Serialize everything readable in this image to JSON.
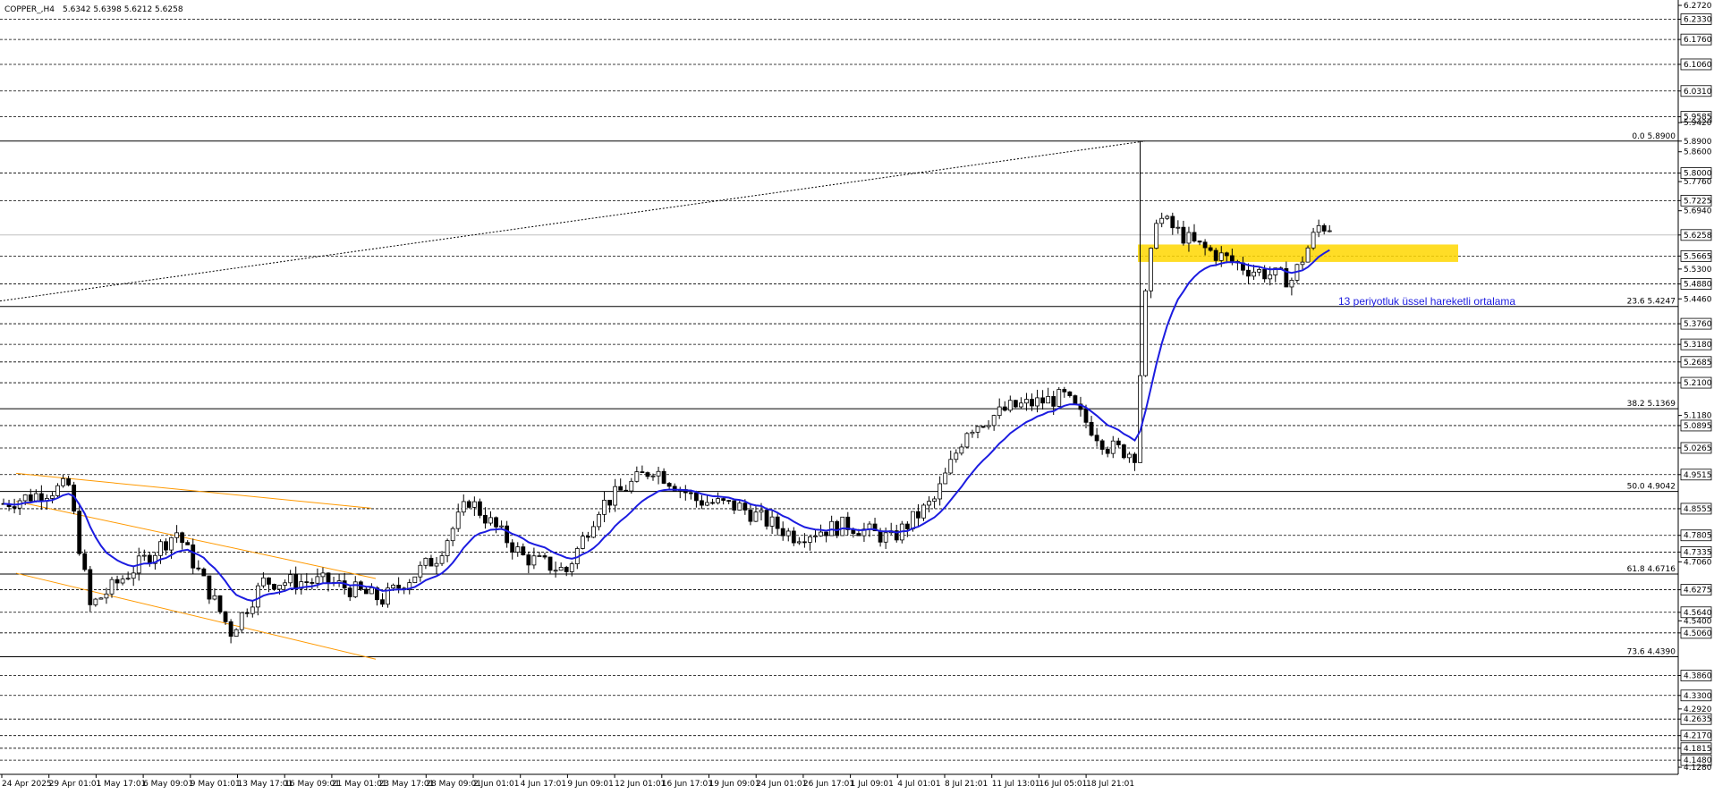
{
  "header": {
    "symbol": "COPPER_,H4",
    "ohlc": "5.6342 5.6398 5.6212 5.6258"
  },
  "chart_data": {
    "type": "candlestick",
    "title": "COPPER_,H4",
    "ylim": [
      4.108,
      6.272
    ],
    "grid": "horizontal dashed price levels",
    "price_axis_ticks": [
      "6.2720",
      "6.2330",
      "6.1760",
      "6.1060",
      "6.0310",
      "5.9585",
      "5.9420",
      "5.8900",
      "5.8600",
      "5.8000",
      "5.7760",
      "5.7225",
      "5.6940",
      "5.6258",
      "5.5665",
      "5.5300",
      "5.4880",
      "5.4460",
      "5.3760",
      "5.3180",
      "5.2685",
      "5.2100",
      "5.1180",
      "5.0895",
      "5.0265",
      "4.9515",
      "4.8555",
      "4.7805",
      "4.7335",
      "4.7060",
      "4.6275",
      "4.5640",
      "4.5400",
      "4.5060",
      "4.3860",
      "4.3300",
      "4.2920",
      "4.2635",
      "4.2170",
      "4.1815",
      "4.1480",
      "4.1280"
    ],
    "levels": [
      6.233,
      6.176,
      6.106,
      6.031,
      5.9585,
      5.8,
      5.7225,
      5.5665,
      5.488,
      5.376,
      5.318,
      5.2685,
      5.21,
      5.0895,
      5.0265,
      4.9515,
      4.8555,
      4.7805,
      4.7335,
      4.6275,
      4.564,
      4.506,
      4.386,
      4.33,
      4.2635,
      4.217,
      4.1815,
      4.148
    ],
    "current_price": 5.6258,
    "time_axis_labels": [
      "24 Apr 2025",
      "29 Apr 01:01",
      "1 May 17:01",
      "6 May 09:01",
      "9 May 01:01",
      "13 May 17:01",
      "16 May 09:01",
      "21 May 01:01",
      "23 May 17:01",
      "28 May 09:01",
      "2 Jun 01:01",
      "4 Jun 17:01",
      "9 Jun 09:01",
      "12 Jun 01:01",
      "16 Jun 17:01",
      "19 Jun 09:01",
      "24 Jun 01:01",
      "26 Jun 17:01",
      "1 Jul 09:01",
      "4 Jul 01:01",
      "8 Jul 21:01",
      "11 Jul 13:01",
      "16 Jul 05:01",
      "18 Jul 21:01"
    ],
    "fibonacci": [
      {
        "label": "0.0 5.8900",
        "price": 5.89
      },
      {
        "label": "23.6 5.4247",
        "price": 5.4247
      },
      {
        "label": "38.2 5.1369",
        "price": 5.1369
      },
      {
        "label": "50.0 4.9042",
        "price": 4.9042
      },
      {
        "label": "61.8 4.6716",
        "price": 4.6716
      },
      {
        "label": "73.6 4.4390",
        "price": 4.439
      }
    ],
    "anchor_prices": [
      {
        "bar": 0,
        "price": 4.87
      },
      {
        "bar": 12,
        "price": 4.92
      },
      {
        "bar": 16,
        "price": 4.58
      },
      {
        "bar": 22,
        "price": 4.66
      },
      {
        "bar": 32,
        "price": 4.79
      },
      {
        "bar": 42,
        "price": 4.51
      },
      {
        "bar": 48,
        "price": 4.65
      },
      {
        "bar": 60,
        "price": 4.65
      },
      {
        "bar": 70,
        "price": 4.6
      },
      {
        "bar": 80,
        "price": 4.72
      },
      {
        "bar": 86,
        "price": 4.88
      },
      {
        "bar": 96,
        "price": 4.72
      },
      {
        "bar": 104,
        "price": 4.68
      },
      {
        "bar": 110,
        "price": 4.86
      },
      {
        "bar": 120,
        "price": 4.97
      },
      {
        "bar": 128,
        "price": 4.88
      },
      {
        "bar": 136,
        "price": 4.86
      },
      {
        "bar": 146,
        "price": 4.78
      },
      {
        "bar": 156,
        "price": 4.81
      },
      {
        "bar": 164,
        "price": 4.77
      },
      {
        "bar": 172,
        "price": 4.88
      },
      {
        "bar": 178,
        "price": 5.08
      },
      {
        "bar": 186,
        "price": 5.14
      },
      {
        "bar": 196,
        "price": 5.17
      },
      {
        "bar": 204,
        "price": 5.03
      },
      {
        "bar": 209,
        "price": 5.01
      },
      {
        "bar": 211,
        "price": 5.45
      },
      {
        "bar": 213,
        "price": 5.68
      },
      {
        "bar": 220,
        "price": 5.6
      },
      {
        "bar": 230,
        "price": 5.53
      },
      {
        "bar": 238,
        "price": 5.5
      },
      {
        "bar": 243,
        "price": 5.65
      }
    ],
    "series": [
      {
        "name": "13 periyotluk üssel hareketli ortalama",
        "color": "#1c1ce0",
        "kind": "EMA(13)"
      }
    ],
    "channel": {
      "color": "#ff9900",
      "lines": [
        [
          4.955,
          4.857
        ],
        [
          4.876,
          4.659
        ],
        [
          4.674,
          4.432
        ]
      ]
    },
    "trendline": {
      "from_price": 5.44,
      "to_price": 5.89
    },
    "zone": {
      "color": "#ffd700",
      "from_price": 5.55,
      "to_price": 5.599
    },
    "annotation": "13 periyotluk üssel hareketli ortalama"
  },
  "colors": {
    "candle": "#000000",
    "ema": "#1c1ce0",
    "channel": "#ff9900",
    "zone": "#ffd700",
    "grid": "#000000",
    "current_line": "#c0c0c0"
  }
}
